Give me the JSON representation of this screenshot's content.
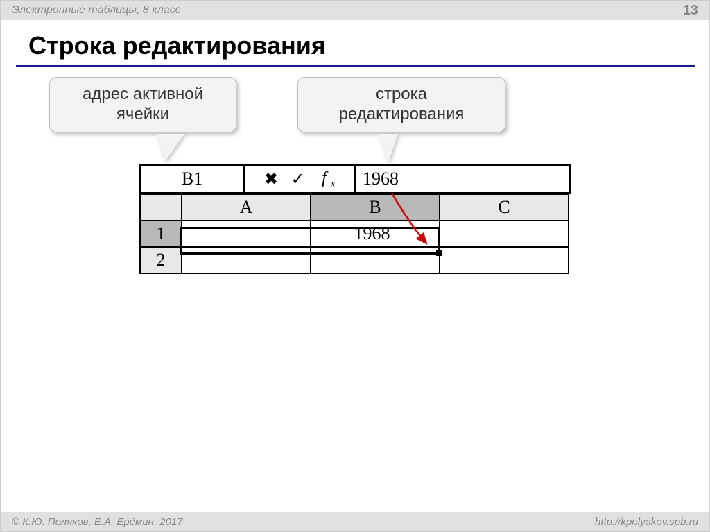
{
  "header": {
    "left": "Электронные таблицы, 8 класс",
    "page": "13"
  },
  "title": "Строка редактирования",
  "callouts": {
    "address": "адрес активной ячейки",
    "editline": "строка редактирования"
  },
  "formula_bar": {
    "name_box": "B1",
    "cancel_glyph": "✖",
    "accept_glyph": "✓",
    "fx_label": "f",
    "fx_sub": "x",
    "edit_value": "1968"
  },
  "grid": {
    "columns": [
      "A",
      "B",
      "C"
    ],
    "rows": [
      "1",
      "2"
    ],
    "active_cell_value": "1968"
  },
  "footer": {
    "left": "© К.Ю. Поляков, Е.А. Ерёмин, 2017",
    "right": "http://kpolyakov.spb.ru"
  }
}
